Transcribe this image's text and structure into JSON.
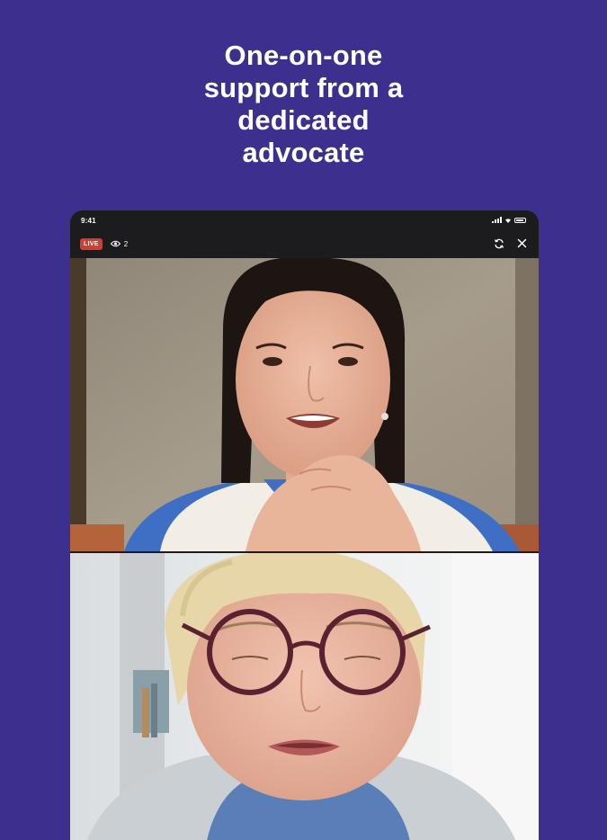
{
  "headline": {
    "lines": [
      "One-on-one",
      "support from a",
      "dedicated",
      "advocate"
    ]
  },
  "device": {
    "status_bar": {
      "time": "9:41"
    },
    "toolbar": {
      "live_label": "LIVE",
      "viewer_count": "2",
      "icons": [
        "eye-icon",
        "switch-camera-icon",
        "close-icon"
      ]
    },
    "videos": [
      {
        "name": "advocate-video"
      },
      {
        "name": "user-video"
      }
    ]
  },
  "colors": {
    "background": "#3c2f8e",
    "live_badge": "#d63b30",
    "device_frame": "#1c1c1e",
    "headline_text": "#ffffff"
  }
}
